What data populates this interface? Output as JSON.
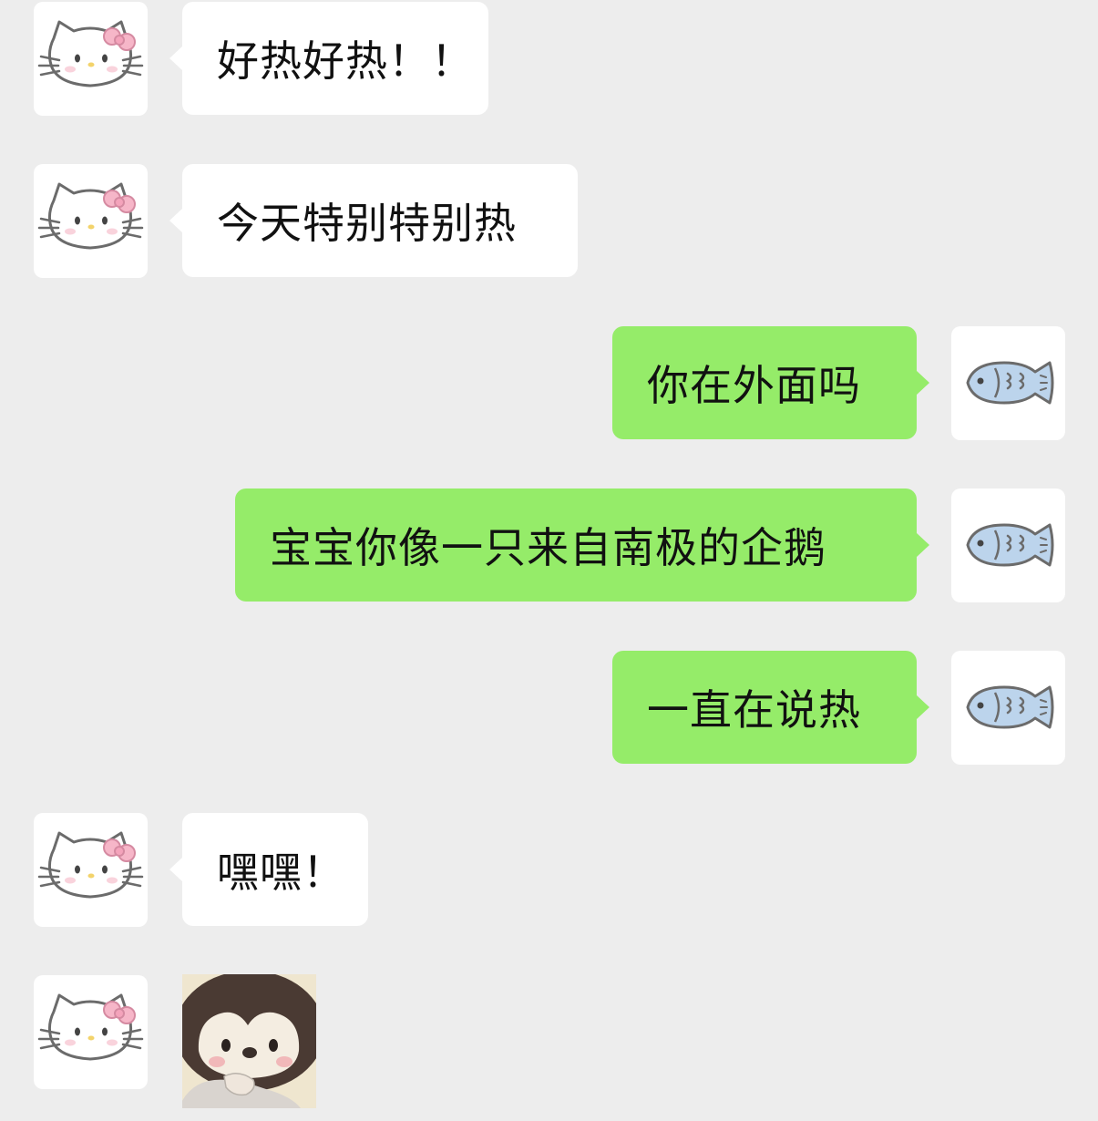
{
  "messages": [
    {
      "side": "in",
      "text": "好热好热！！"
    },
    {
      "side": "in",
      "text": "今天特别特别热"
    },
    {
      "side": "out",
      "text": "你在外面吗"
    },
    {
      "side": "out",
      "text": "宝宝你像一只来自南极的企鹅"
    },
    {
      "side": "out",
      "text": "一直在说热"
    },
    {
      "side": "in",
      "text": "嘿嘿！"
    },
    {
      "side": "in",
      "sticker": "penguin-sticker"
    }
  ],
  "avatars": {
    "contact": "hello-kitty-icon",
    "self": "fish-icon"
  },
  "colors": {
    "background": "#ededed",
    "incoming_bubble": "#ffffff",
    "outgoing_bubble": "#95ec69",
    "text": "#111111"
  }
}
